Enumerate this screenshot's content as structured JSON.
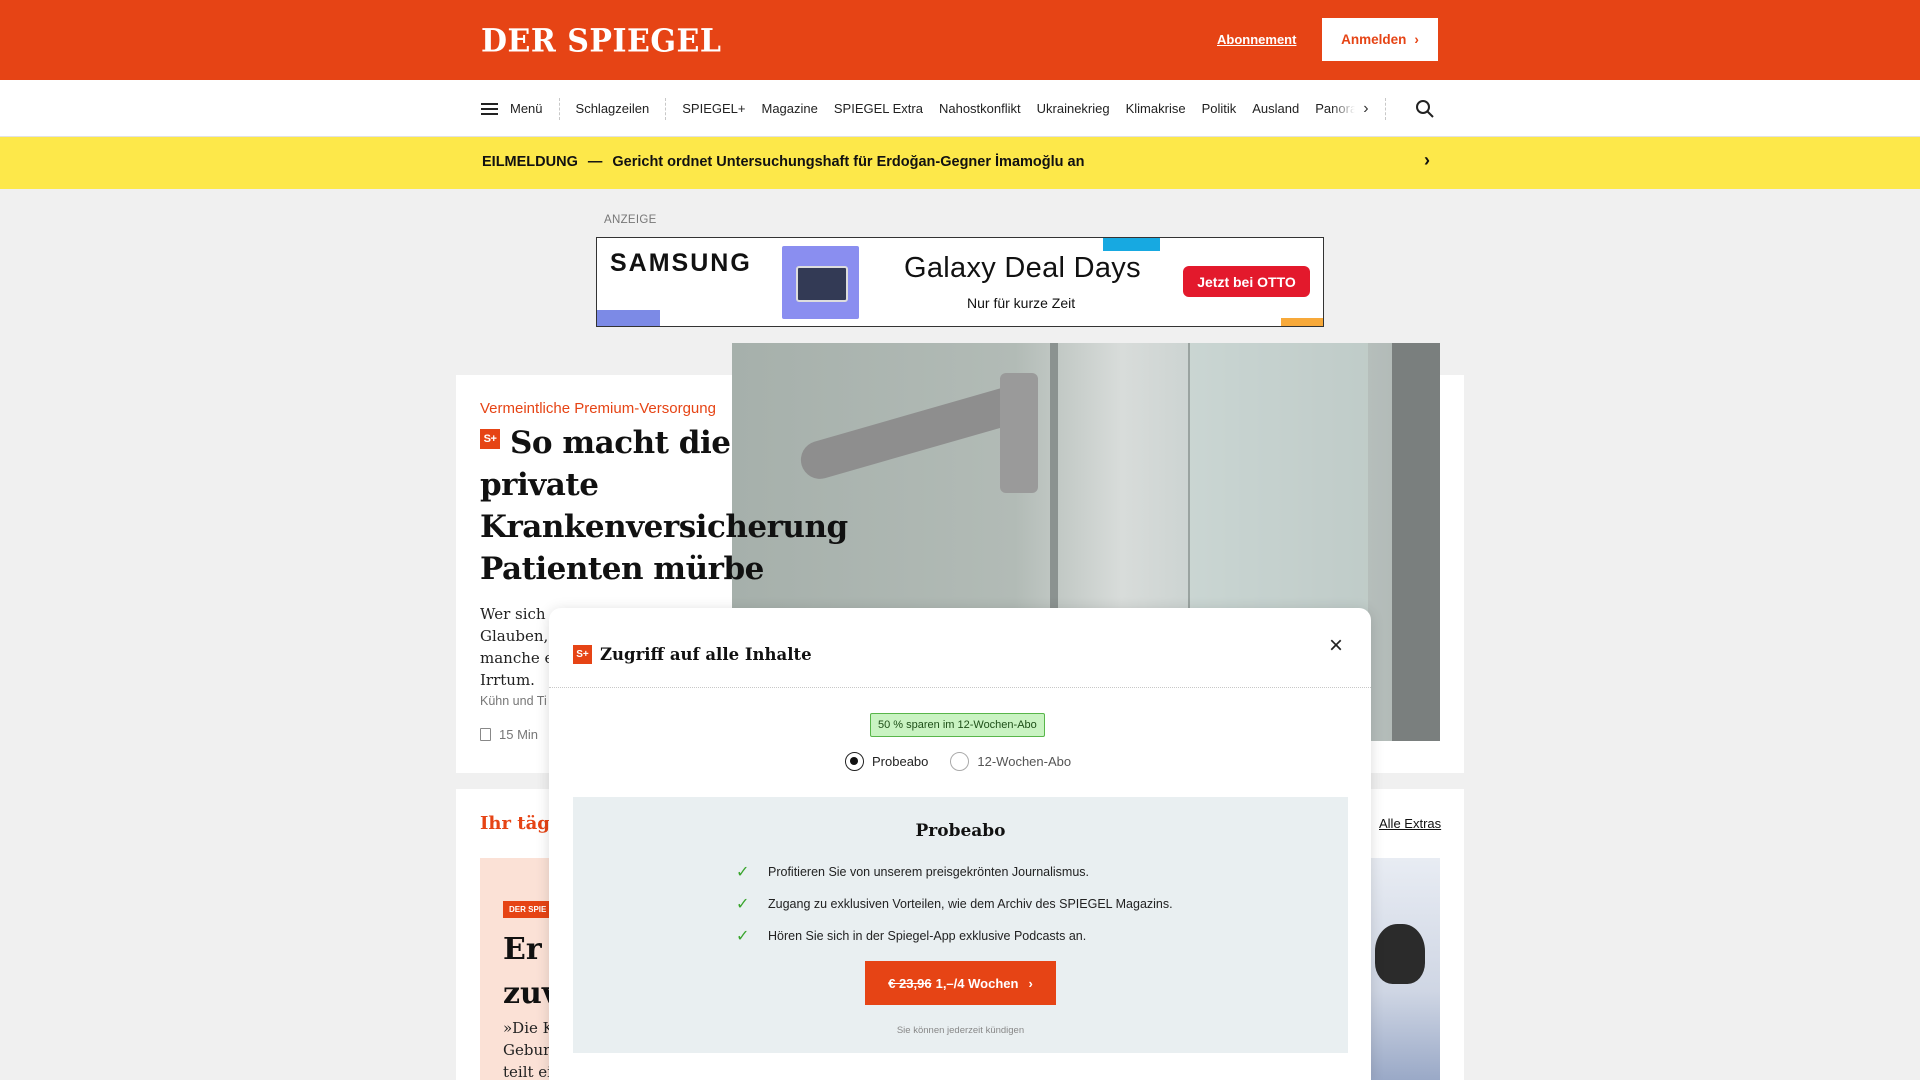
{
  "header": {
    "logo": "DER SPIEGEL",
    "subscription_link": "Abonnement",
    "login_button": "Anmelden"
  },
  "nav": {
    "menu_label": "Menü",
    "items": [
      "Schlagzeilen",
      "SPIEGEL+",
      "Magazine",
      "SPIEGEL Extra",
      "Nahostkonflikt",
      "Ukrainekrieg",
      "Klimakrise",
      "Politik",
      "Ausland"
    ],
    "truncated_item": "Panorama"
  },
  "breaking": {
    "label": "EILMELDUNG",
    "dash": "—",
    "text": "Gericht ordnet Untersuchungshaft für Erdoğan-Gegner İmamoğlu an"
  },
  "ad": {
    "label": "ANZEIGE",
    "brand": "SAMSUNG",
    "headline": "Galaxy Deal Days",
    "subline": "Nur für kurze Zeit",
    "cta": "Jetzt bei OTTO"
  },
  "article": {
    "kicker": "Vermeintliche Premium-Versorgung",
    "premium_badge": "S+",
    "headline": "So macht die private Krankenversicherung Patienten mürbe",
    "teaser_lines": [
      "Wer sich p",
      "Glauben,",
      "manche e",
      "Irrtum."
    ],
    "authors": "Kühn und Ti",
    "read_time": "15 Min"
  },
  "extras": {
    "title": "Ihr täglic",
    "all_link": "Alle Extras",
    "tile_badge": "DER SPIE",
    "tile_headline_lines": [
      "Er",
      "zuv"
    ],
    "tile_text_lines": [
      "»Die K",
      "Gebur",
      "teilt ei"
    ]
  },
  "modal": {
    "title": "Zugriff auf alle Inhalte",
    "savings_badge": "50 % sparen im 12-Wochen-Abo",
    "option_1": "Probeabo",
    "option_2": "12-Wochen-Abo",
    "plan_title": "Probeabo",
    "benefits": [
      "Profitieren Sie von unserem preisgekrönten Journalismus.",
      "Zugang zu exklusiven Vorteilen, wie dem Archiv des SPIEGEL Magazins.",
      "Hören Sie sich in der Spiegel-App exklusive Podcasts an."
    ],
    "cta_old_price": "€ 23,96",
    "cta_new_price": "1,–/4 Wochen",
    "cancel_note": "Sie können jederzeit kündigen"
  },
  "colors": {
    "brand": "#e64415",
    "breaking_bg": "#fde84a",
    "savings_bg": "#c9f3c2",
    "check": "#3aa52e"
  }
}
